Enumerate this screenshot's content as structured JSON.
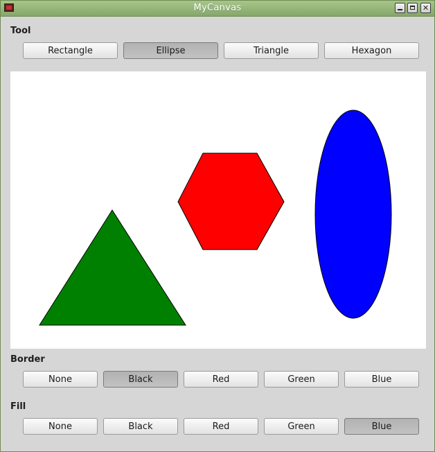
{
  "window": {
    "title": "MyCanvas"
  },
  "tool": {
    "label": "Tool",
    "buttons": [
      "Rectangle",
      "Ellipse",
      "Triangle",
      "Hexagon"
    ],
    "selected": "Ellipse"
  },
  "border": {
    "label": "Border",
    "buttons": [
      "None",
      "Black",
      "Red",
      "Green",
      "Blue"
    ],
    "selected": "Black"
  },
  "fill": {
    "label": "Fill",
    "buttons": [
      "None",
      "Black",
      "Red",
      "Green",
      "Blue"
    ],
    "selected": "Blue"
  },
  "canvas": {
    "shapes": [
      {
        "type": "triangle",
        "fill": "#008000",
        "stroke": "#000000"
      },
      {
        "type": "hexagon",
        "fill": "#ff0000",
        "stroke": "#000000"
      },
      {
        "type": "ellipse",
        "fill": "#0000ff",
        "stroke": "#000000"
      }
    ]
  },
  "colors": {
    "titlebar": "#96b67a",
    "background": "#d6d6d6",
    "canvas": "#ffffff",
    "selected_button": "#b8b8b8"
  }
}
